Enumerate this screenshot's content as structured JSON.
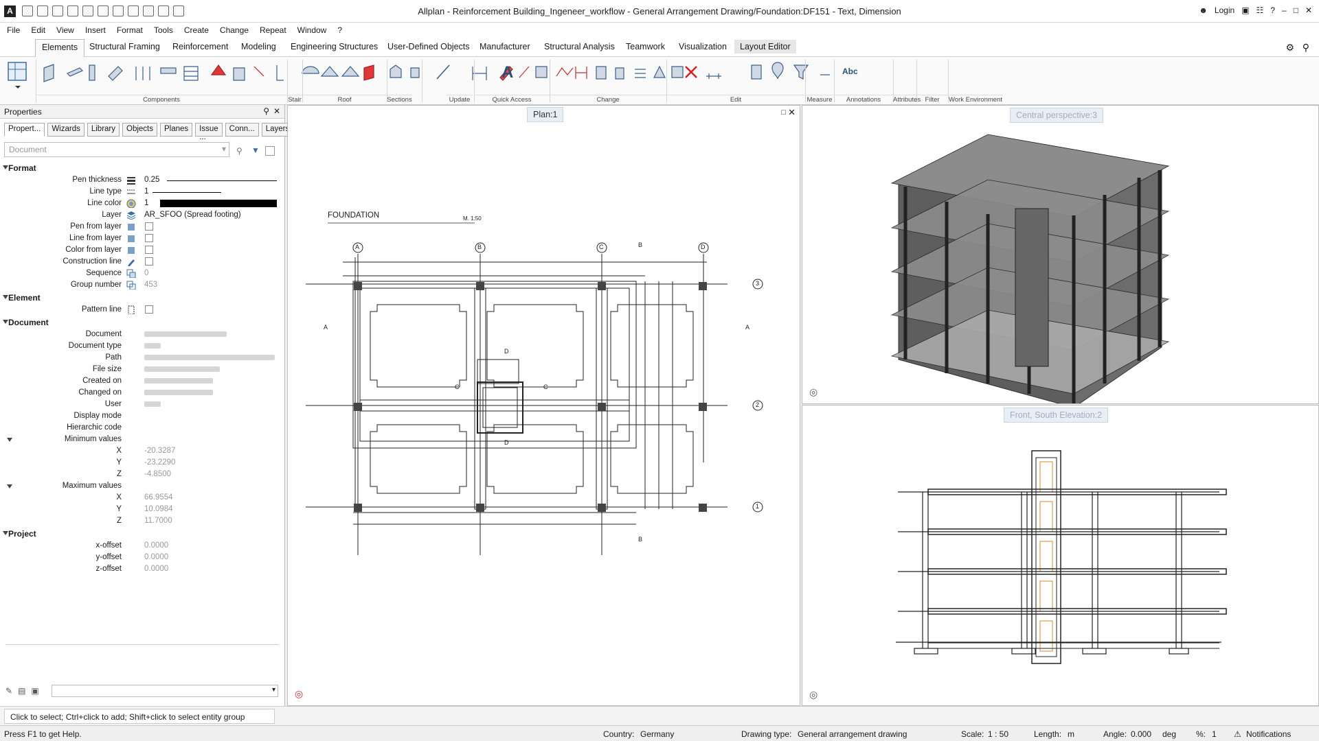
{
  "app": {
    "title": "Allplan - Reinforcement Building_Ingeneer_workflow - General Arrangement Drawing/Foundation:DF151 - Text, Dimension",
    "login": "Login"
  },
  "menu": [
    "File",
    "Edit",
    "View",
    "Insert",
    "Format",
    "Tools",
    "Create",
    "Change",
    "Repeat",
    "Window",
    "?"
  ],
  "tabs": [
    "Elements",
    "Structural Framing",
    "Reinforcement",
    "Modeling",
    "Engineering Structures",
    "User-Defined Objects",
    "Manufacturer",
    "Structural Analysis",
    "Teamwork",
    "Visualization",
    "Layout Editor"
  ],
  "ribbon_groups": [
    "Components",
    "Stair",
    "Roof",
    "Sections",
    "Update",
    "Quick Access",
    "Change",
    "Edit",
    "Measure",
    "Annotations",
    "Attributes",
    "Filter",
    "Work Environment"
  ],
  "ribbon_text_icon": "A",
  "ribbon_abc": "Abc",
  "properties": {
    "title": "Properties",
    "tabs": [
      "Propert...",
      "Wizards",
      "Library",
      "Objects",
      "Planes",
      "Issue ...",
      "Conn...",
      "Layers"
    ],
    "doc_placeholder": "Document",
    "sections": {
      "format": "Format",
      "element": "Element",
      "document": "Document",
      "project": "Project"
    },
    "format": {
      "pen_thickness_label": "Pen thickness",
      "pen_thickness": "0.25",
      "line_type_label": "Line type",
      "line_type": "1",
      "line_color_label": "Line color",
      "line_color": "1",
      "layer_label": "Layer",
      "layer": "AR_SFOO (Spread footing)",
      "pen_from_layer": "Pen from layer",
      "line_from_layer": "Line from layer",
      "color_from_layer": "Color from layer",
      "construction_line": "Construction line",
      "sequence_label": "Sequence",
      "sequence": "0",
      "group_label": "Group number",
      "group": "453"
    },
    "element": {
      "pattern_line": "Pattern line"
    },
    "document": {
      "document": "Document",
      "document_type": "Document type",
      "path": "Path",
      "file_size": "File size",
      "created_on": "Created on",
      "changed_on": "Changed on",
      "user": "User",
      "display_mode": "Display mode",
      "hierarchic_code": "Hierarchic code",
      "minimum_values": "Minimum values",
      "maximum_values": "Maximum values",
      "x": "X",
      "y": "Y",
      "z": "Z",
      "min_x": "-20.3287",
      "min_y": "-23.2290",
      "min_z": "-4.8500",
      "max_x": "66.9554",
      "max_y": "10.0984",
      "max_z": "11.7000"
    },
    "project": {
      "x_offset_label": "x-offset",
      "x_offset": "0.0000",
      "y_offset_label": "y-offset",
      "y_offset": "0.0000",
      "z_offset_label": "z-offset",
      "z_offset": "0.0000"
    }
  },
  "viewports": {
    "plan": "Plan:1",
    "perspective": "Central perspective:3",
    "elevation": "Front, South Elevation:2"
  },
  "drawing": {
    "title": "FOUNDATION",
    "scale": "M. 1:50",
    "grid_cols": [
      "A",
      "B",
      "C",
      "D"
    ],
    "grid_rows": [
      "3",
      "2",
      "1"
    ],
    "section_a": "A",
    "section_b": "B",
    "section_c": "C",
    "section_d": "D"
  },
  "status": {
    "hint": "Click to select; Ctrl+click to add; Shift+click to select entity group",
    "help": "Press F1 to get Help.",
    "country_label": "Country:",
    "country": "Germany",
    "drawing_type_label": "Drawing type:",
    "drawing_type": "General arrangement drawing",
    "scale_label": "Scale:",
    "scale": "1 : 50",
    "length_label": "Length:",
    "length": "m",
    "angle_label": "Angle:",
    "angle": "0.000",
    "angle_unit": "deg",
    "percent_label": "%:",
    "percent": "1",
    "notifications": "Notifications"
  }
}
